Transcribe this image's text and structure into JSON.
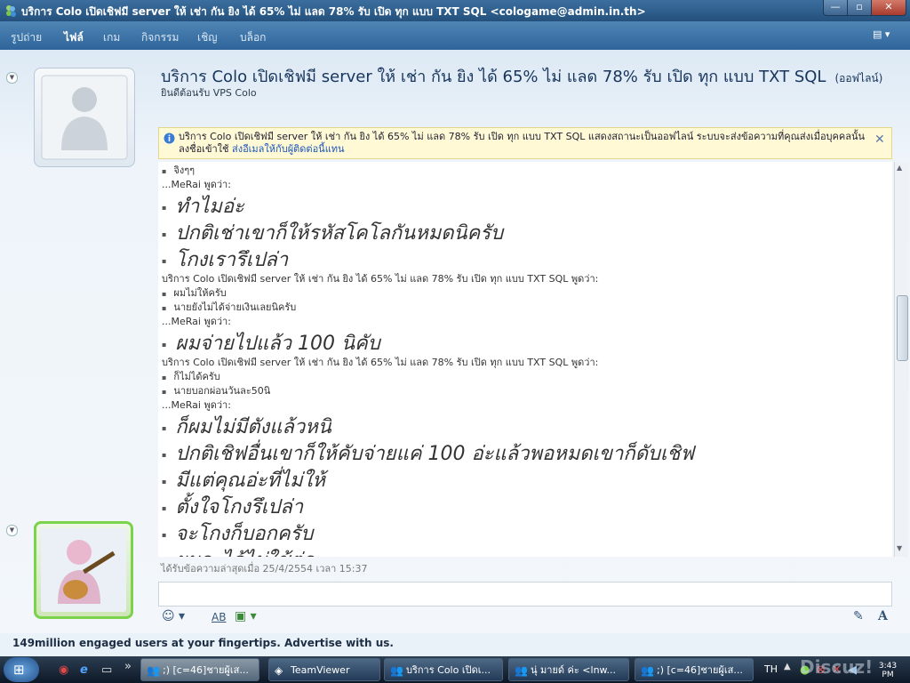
{
  "window": {
    "title": "บริการ Colo เปิดเชิฟมี server ให้ เช่า กัน ยิง ได้ 65% ไม่ แลด 78% รับ เปิด ทุก แบบ TXT SQL <cologame@admin.in.th>",
    "min": "—",
    "max": "▫",
    "close": "✕"
  },
  "menu": {
    "items": [
      {
        "label": "รูปถ่าย"
      },
      {
        "label": "ไฟล์"
      },
      {
        "label": "เกม"
      },
      {
        "label": "กิจกรรม"
      },
      {
        "label": "เชิญ"
      },
      {
        "label": "บล็อก"
      }
    ],
    "options_glyph": "▤ ▾"
  },
  "contact": {
    "name": "บริการ Colo เปิดเชิฟมี server ให้ เช่า กัน ยิง ได้ 65% ไม่ แลด 78% รับ เปิด ทุก แบบ TXT SQL",
    "status": "(ออฟไลน์)",
    "personal_message": "ยินดีต้อนรับ VPS Colo"
  },
  "notice": {
    "text": "บริการ Colo เปิดเชิฟมี server ให้ เช่า กัน ยิง ได้ 65% ไม่ แลด 78% รับ เปิด ทุก แบบ TXT SQL แสดงสถานะเป็นออฟไลน์ ระบบจะส่งข้อความที่คุณส่งเมื่อบุคคลนั้นลงชื่อเข้าใช้",
    "link": "ส่งอีเมลให้กับผู้ติดต่อนี้แทน",
    "close": "✕"
  },
  "conversation": [
    {
      "type": "small",
      "bullet": true,
      "text": "จิงๆๆ"
    },
    {
      "type": "sender",
      "text": "...MeRai พูดว่า:"
    },
    {
      "type": "big",
      "text": "ทำไมอ่ะ"
    },
    {
      "type": "big",
      "text": "ปกติเช่าเขาก็ให้รหัสโคโลกันหมดนิครับ"
    },
    {
      "type": "big",
      "text": "โกงเรารึเปล่า"
    },
    {
      "type": "sender",
      "text": "บริการ Colo เปิดเชิฟมี server ให้ เช่า กัน ยิง ได้ 65% ไม่ แลด 78% รับ เปิด ทุก แบบ TXT SQL พูดว่า:"
    },
    {
      "type": "small",
      "bullet": true,
      "text": "ผมไม่ให้ครับ"
    },
    {
      "type": "small",
      "bullet": true,
      "text": "นายยังไม่ได้จ่ายเงินเลยนิครับ"
    },
    {
      "type": "sender",
      "text": "...MeRai พูดว่า:"
    },
    {
      "type": "big",
      "text": "ผมจ่ายไปแล้ว 100 นิคับ"
    },
    {
      "type": "sender",
      "text": "บริการ Colo เปิดเชิฟมี server ให้ เช่า กัน ยิง ได้ 65% ไม่ แลด 78% รับ เปิด ทุก แบบ TXT SQL พูดว่า:"
    },
    {
      "type": "small",
      "bullet": true,
      "text": "ก็ไม่ได้ครับ"
    },
    {
      "type": "small",
      "bullet": true,
      "text": "นายบอกผ่อนวันละ50นิ"
    },
    {
      "type": "sender",
      "text": "...MeRai พูดว่า:"
    },
    {
      "type": "big",
      "text": "ก็ผมไม่มีตังแล้วหนิ"
    },
    {
      "type": "big",
      "text": "ปกติเชิฟอื่นเขาก็ให้คับจ่ายแค่ 100 อ่ะแล้วพอหมดเขาก็ดับเชิฟ"
    },
    {
      "type": "big",
      "text": "มีแต่คุณอ่ะที่ไม่ให้"
    },
    {
      "type": "big",
      "text": "ตั้งใจโกงรึเปล่า"
    },
    {
      "type": "big",
      "text": "จะโกงก็บอกครับ"
    },
    {
      "type": "big",
      "text": "ผมจะได้ไม่ใช้ต่อ"
    }
  ],
  "last_received": "ได้รับข้อความล่าสุดเมื่อ 25/4/2554 เวลา 15:37",
  "toolbar": {
    "emoticon": "☺ ▾",
    "font": "AB",
    "background": "▣ ▾",
    "pen": "✎",
    "text_style": "A"
  },
  "advert": "149million engaged users at your fingertips. Advertise with us.",
  "taskbar": {
    "start": "⊞",
    "quicklaunch": [
      "◉",
      "e",
      "▭",
      "»"
    ],
    "tasks": [
      {
        "label": ";) [c=46]ชายผู้เส...",
        "active": true
      },
      {
        "label": "TeamViewer",
        "active": false
      },
      {
        "label": "บริการ Colo เปิดเ...",
        "active": false
      },
      {
        "label": "นุ่ มายด์ ค่ะ <lnw...",
        "active": false
      },
      {
        "label": ";) [c=46]ชายผู้เส...",
        "active": false
      }
    ],
    "language": "TH",
    "clock": "3:43\nPM"
  },
  "watermark": "Discuz!"
}
